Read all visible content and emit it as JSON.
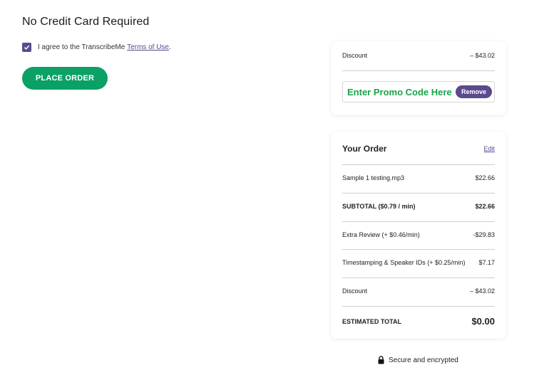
{
  "heading": "No Credit Card Required",
  "agreement": {
    "text": "I agree to the TranscribeMe ",
    "link": "Terms of Use",
    "suffix": ".",
    "checked": true
  },
  "place_order_label": "PLACE ORDER",
  "promo_card": {
    "discount_label": "Discount",
    "discount_value": "– $43.02",
    "promo_text": "Enter Promo Code Here",
    "remove_label": "Remove"
  },
  "order": {
    "title": "Your Order",
    "edit_label": "Edit",
    "lines": [
      {
        "label": "Sample 1 testing.mp3",
        "value": "$22.66"
      },
      {
        "label": "SUBTOTAL ($0.79 / min)",
        "value": "$22.66"
      },
      {
        "label": "Extra Review (+ $0.46/min)",
        "value": "-$29.83"
      },
      {
        "label": "Timestamping & Speaker IDs (+ $0.25/min)",
        "value": "$7.17"
      },
      {
        "label": "Discount",
        "value": "– $43.02"
      }
    ],
    "total_label": "ESTIMATED TOTAL",
    "total_value": "$0.00"
  },
  "secure_text": "Secure and encrypted",
  "colors": {
    "accent_purple": "#5b4a8e",
    "button_green": "#0aa066",
    "promo_green": "#1aa34a"
  }
}
